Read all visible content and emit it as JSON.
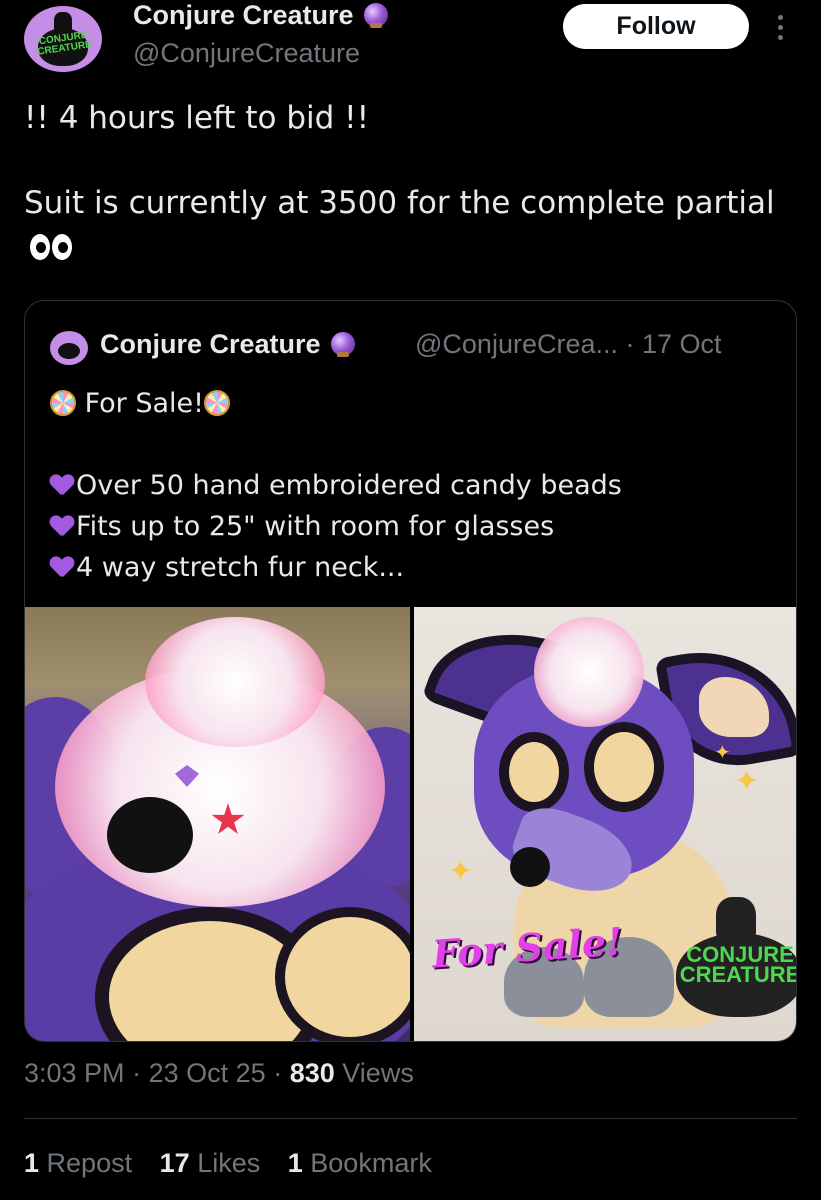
{
  "author": {
    "display_name": "Conjure Creature",
    "handle": "@ConjureCreature",
    "avatar_text": "CONJURE CREATURE",
    "verified_icon": "crystal-ball-icon"
  },
  "follow_label": "Follow",
  "tweet": {
    "line1": "!! 4 hours left to bid !!",
    "line2": "Suit is currently at 3500 for the complete partial",
    "emoji": "eyes-icon"
  },
  "quoted_tweet": {
    "display_name": "Conjure Creature",
    "handle": "@ConjureCrea...",
    "time": "· 17 Oct",
    "title": "For Sale!",
    "bullets": [
      "Over 50 hand embroidered candy beads",
      "Fits up to 25\" with room for glasses",
      "4 way stretch fur neck..."
    ],
    "images": [
      {
        "name": "fursuit-closeup-photo"
      },
      {
        "name": "fursuit-full-photo",
        "overlay_text": "For Sale!",
        "logo_text": "CONJURE CREATURE"
      }
    ]
  },
  "meta": {
    "time": "3:03 PM",
    "sep1": "·",
    "date": "23 Oct 25",
    "sep2": "·",
    "views_count": "830",
    "views_label": "Views"
  },
  "stats": {
    "reposts_count": "1",
    "reposts_label": "Repost",
    "likes_count": "17",
    "likes_label": "Likes",
    "bookmarks_count": "1",
    "bookmarks_label": "Bookmark"
  },
  "colors": {
    "background": "#000000",
    "text_primary": "#e7e9ea",
    "text_secondary": "#71767b",
    "border": "#2f3336",
    "heart_purple": "#a35ae0"
  }
}
